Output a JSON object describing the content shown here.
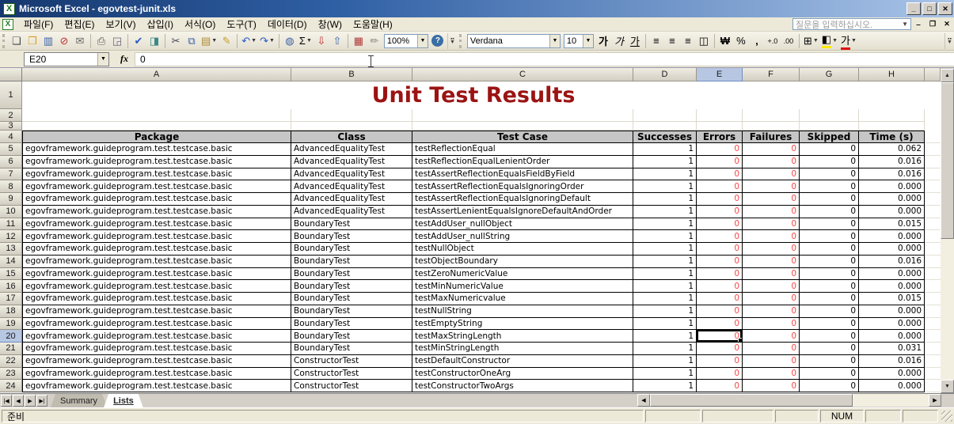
{
  "window": {
    "title": "Microsoft Excel - egovtest-junit.xls"
  },
  "menu": {
    "items": [
      "파일(F)",
      "편집(E)",
      "보기(V)",
      "삽입(I)",
      "서식(O)",
      "도구(T)",
      "데이터(D)",
      "창(W)",
      "도움말(H)"
    ],
    "question_placeholder": "질문을 입력하십시오."
  },
  "toolbar_standard": {
    "buttons": [
      {
        "name": "new-document-icon",
        "glyph": "❏",
        "color": "#444"
      },
      {
        "name": "open-folder-icon",
        "glyph": "❒",
        "color": "#d8a020"
      },
      {
        "name": "save-icon",
        "glyph": "▥",
        "color": "#3a62a8"
      },
      {
        "name": "permission-icon",
        "glyph": "⊘",
        "color": "#c03030"
      },
      {
        "name": "email-icon",
        "glyph": "✉",
        "color": "#666"
      },
      {
        "name": "print-icon",
        "glyph": "⎙",
        "color": "#555",
        "sep_before": true
      },
      {
        "name": "print-preview-icon",
        "glyph": "◲",
        "color": "#667"
      },
      {
        "name": "spelling-icon",
        "glyph": "✔",
        "color": "#2858c8",
        "sep_before": true
      },
      {
        "name": "research-icon",
        "glyph": "◨",
        "color": "#3a8888"
      },
      {
        "name": "cut-icon",
        "glyph": "✂",
        "color": "#445",
        "sep_before": true
      },
      {
        "name": "copy-icon",
        "glyph": "⧉",
        "color": "#3a62a8"
      },
      {
        "name": "paste-icon",
        "glyph": "▤",
        "color": "#b08830",
        "dropdown": true
      },
      {
        "name": "format-painter-icon",
        "glyph": "✎",
        "color": "#c8a030"
      },
      {
        "name": "undo-icon",
        "glyph": "↶",
        "color": "#2858c8",
        "dropdown": true,
        "sep_before": true
      },
      {
        "name": "redo-icon",
        "glyph": "↷",
        "color": "#2858c8",
        "dropdown": true
      },
      {
        "name": "hyperlink-icon",
        "glyph": "◍",
        "color": "#3a62a8",
        "sep_before": true
      },
      {
        "name": "autosum-icon",
        "glyph": "Σ",
        "color": "#000",
        "dropdown": true
      },
      {
        "name": "sort-ascending-icon",
        "glyph": "⇩",
        "color": "#c03030"
      },
      {
        "name": "sort-descending-icon",
        "glyph": "⇧",
        "color": "#3a62a8"
      },
      {
        "name": "chart-wizard-icon",
        "glyph": "▦",
        "color": "#b03838",
        "sep_before": true
      },
      {
        "name": "drawing-icon",
        "glyph": "✏",
        "color": "#888"
      }
    ],
    "zoom_value": "100%",
    "help_glyph": "?"
  },
  "toolbar_formatting": {
    "font_name": "Verdana",
    "font_size": "10",
    "buttons": [
      {
        "name": "bold-button",
        "glyph": "가",
        "cls": "b"
      },
      {
        "name": "italic-button",
        "glyph": "가",
        "cls": "i"
      },
      {
        "name": "underline-button",
        "glyph": "가",
        "cls": "u"
      },
      {
        "name": "align-left-icon",
        "glyph": "≡",
        "cls": "",
        "sep_before": true
      },
      {
        "name": "align-center-icon",
        "glyph": "≡",
        "cls": ""
      },
      {
        "name": "align-right-icon",
        "glyph": "≡",
        "cls": ""
      },
      {
        "name": "merge-center-icon",
        "glyph": "◫",
        "cls": ""
      },
      {
        "name": "currency-icon",
        "glyph": "₩",
        "cls": "b",
        "sep_before": true
      },
      {
        "name": "percent-icon",
        "glyph": "%",
        "cls": ""
      },
      {
        "name": "comma-style-icon",
        "glyph": ",",
        "cls": "b"
      },
      {
        "name": "increase-decimal-icon",
        "glyph": "+.0",
        "cls": ""
      },
      {
        "name": "decrease-decimal-icon",
        "glyph": ".00",
        "cls": ""
      },
      {
        "name": "borders-icon",
        "glyph": "⊞",
        "cls": "",
        "dropdown": true,
        "sep_before": true
      },
      {
        "name": "fill-color-icon",
        "glyph": "◧",
        "cls": "underbar-y",
        "dropdown": true
      },
      {
        "name": "font-color-icon",
        "glyph": "가",
        "cls": "underbar-r",
        "dropdown": true
      }
    ]
  },
  "formula_bar": {
    "name_box": "E20",
    "fx_label": "fx",
    "value": "0"
  },
  "sheet": {
    "title": "Unit Test Results",
    "columns": [
      "A",
      "B",
      "C",
      "D",
      "E",
      "F",
      "G",
      "H"
    ],
    "selected_column_index": 4,
    "selected_row": 20,
    "selected_cell": "E20",
    "table_headers": [
      "Package",
      "Class",
      "Test Case",
      "Successes",
      "Errors",
      "Failures",
      "Skipped",
      "Time (s)"
    ],
    "rows": [
      {
        "n": 5,
        "package": "egovframework.guideprogram.test.testcase.basic",
        "class": "AdvancedEqualityTest",
        "test": "testReflectionEqual",
        "successes": "1",
        "errors": "0",
        "failures": "0",
        "skipped": "0",
        "time": "0.062"
      },
      {
        "n": 6,
        "package": "egovframework.guideprogram.test.testcase.basic",
        "class": "AdvancedEqualityTest",
        "test": "testReflectionEqualLenientOrder",
        "successes": "1",
        "errors": "0",
        "failures": "0",
        "skipped": "0",
        "time": "0.016"
      },
      {
        "n": 7,
        "package": "egovframework.guideprogram.test.testcase.basic",
        "class": "AdvancedEqualityTest",
        "test": "testAssertReflectionEqualsFieldByField",
        "successes": "1",
        "errors": "0",
        "failures": "0",
        "skipped": "0",
        "time": "0.016"
      },
      {
        "n": 8,
        "package": "egovframework.guideprogram.test.testcase.basic",
        "class": "AdvancedEqualityTest",
        "test": "testAssertReflectionEqualsIgnoringOrder",
        "successes": "1",
        "errors": "0",
        "failures": "0",
        "skipped": "0",
        "time": "0.000"
      },
      {
        "n": 9,
        "package": "egovframework.guideprogram.test.testcase.basic",
        "class": "AdvancedEqualityTest",
        "test": "testAssertReflectionEqualsIgnoringDefault",
        "successes": "1",
        "errors": "0",
        "failures": "0",
        "skipped": "0",
        "time": "0.000"
      },
      {
        "n": 10,
        "package": "egovframework.guideprogram.test.testcase.basic",
        "class": "AdvancedEqualityTest",
        "test": "testAssertLenientEqualsIgnoreDefaultAndOrder",
        "successes": "1",
        "errors": "0",
        "failures": "0",
        "skipped": "0",
        "time": "0.000"
      },
      {
        "n": 11,
        "package": "egovframework.guideprogram.test.testcase.basic",
        "class": "BoundaryTest",
        "test": "testAddUser_nullObject",
        "successes": "1",
        "errors": "0",
        "failures": "0",
        "skipped": "0",
        "time": "0.015"
      },
      {
        "n": 12,
        "package": "egovframework.guideprogram.test.testcase.basic",
        "class": "BoundaryTest",
        "test": "testAddUser_nullString",
        "successes": "1",
        "errors": "0",
        "failures": "0",
        "skipped": "0",
        "time": "0.000"
      },
      {
        "n": 13,
        "package": "egovframework.guideprogram.test.testcase.basic",
        "class": "BoundaryTest",
        "test": "testNullObject",
        "successes": "1",
        "errors": "0",
        "failures": "0",
        "skipped": "0",
        "time": "0.000"
      },
      {
        "n": 14,
        "package": "egovframework.guideprogram.test.testcase.basic",
        "class": "BoundaryTest",
        "test": "testObjectBoundary",
        "successes": "1",
        "errors": "0",
        "failures": "0",
        "skipped": "0",
        "time": "0.016"
      },
      {
        "n": 15,
        "package": "egovframework.guideprogram.test.testcase.basic",
        "class": "BoundaryTest",
        "test": "testZeroNumericValue",
        "successes": "1",
        "errors": "0",
        "failures": "0",
        "skipped": "0",
        "time": "0.000"
      },
      {
        "n": 16,
        "package": "egovframework.guideprogram.test.testcase.basic",
        "class": "BoundaryTest",
        "test": "testMinNumericValue",
        "successes": "1",
        "errors": "0",
        "failures": "0",
        "skipped": "0",
        "time": "0.000"
      },
      {
        "n": 17,
        "package": "egovframework.guideprogram.test.testcase.basic",
        "class": "BoundaryTest",
        "test": "testMaxNumericvalue",
        "successes": "1",
        "errors": "0",
        "failures": "0",
        "skipped": "0",
        "time": "0.015"
      },
      {
        "n": 18,
        "package": "egovframework.guideprogram.test.testcase.basic",
        "class": "BoundaryTest",
        "test": "testNullString",
        "successes": "1",
        "errors": "0",
        "failures": "0",
        "skipped": "0",
        "time": "0.000"
      },
      {
        "n": 19,
        "package": "egovframework.guideprogram.test.testcase.basic",
        "class": "BoundaryTest",
        "test": "testEmptyString",
        "successes": "1",
        "errors": "0",
        "failures": "0",
        "skipped": "0",
        "time": "0.000"
      },
      {
        "n": 20,
        "package": "egovframework.guideprogram.test.testcase.basic",
        "class": "BoundaryTest",
        "test": "testMaxStringLength",
        "successes": "1",
        "errors": "0",
        "failures": "0",
        "skipped": "0",
        "time": "0.000"
      },
      {
        "n": 21,
        "package": "egovframework.guideprogram.test.testcase.basic",
        "class": "BoundaryTest",
        "test": "testMinStringLength",
        "successes": "1",
        "errors": "0",
        "failures": "0",
        "skipped": "0",
        "time": "0.031"
      },
      {
        "n": 22,
        "package": "egovframework.guideprogram.test.testcase.basic",
        "class": "ConstructorTest",
        "test": "testDefaultConstructor",
        "successes": "1",
        "errors": "0",
        "failures": "0",
        "skipped": "0",
        "time": "0.016"
      },
      {
        "n": 23,
        "package": "egovframework.guideprogram.test.testcase.basic",
        "class": "ConstructorTest",
        "test": "testConstructorOneArg",
        "successes": "1",
        "errors": "0",
        "failures": "0",
        "skipped": "0",
        "time": "0.000"
      },
      {
        "n": 24,
        "package": "egovframework.guideprogram.test.testcase.basic",
        "class": "ConstructorTest",
        "test": "testConstructorTwoArgs",
        "successes": "1",
        "errors": "0",
        "failures": "0",
        "skipped": "0",
        "time": "0.000"
      }
    ]
  },
  "sheet_tabs": {
    "tabs": [
      "Summary",
      "Lists"
    ],
    "active": "Lists"
  },
  "status_bar": {
    "ready": "준비",
    "num": "NUM"
  },
  "colors": {
    "title_text": "#9b1313",
    "error_text": "#f94646",
    "table_header_bg": "#c6c6c6",
    "selected_header_bg": "#b7c7e3",
    "titlebar_left": "#16386e",
    "titlebar_right": "#a9c4e8"
  }
}
